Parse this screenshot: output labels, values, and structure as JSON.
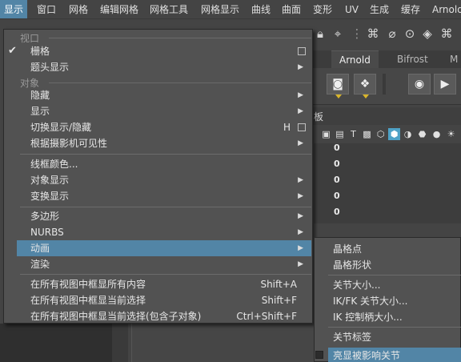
{
  "menubar": {
    "items": [
      "显示",
      "窗口",
      "网格",
      "编辑网格",
      "网格工具",
      "网格显示",
      "曲线",
      "曲面",
      "变形",
      "UV",
      "生成",
      "缓存",
      "Arnold"
    ],
    "active_index": 0
  },
  "toolbar": {
    "icons": [
      "lock-icon",
      "magnet-cursor-icon",
      "snap-grid-icon",
      "snap-curve-icon",
      "snap-point-icon",
      "snap-view-icon",
      "snap-surface-icon",
      "snap-live-icon"
    ]
  },
  "shelf_tabs": {
    "items": [
      "Arnold",
      "Bifrost"
    ],
    "selected": "Arnold"
  },
  "channel_panel": {
    "title": "板",
    "values": [
      "0",
      "0",
      "0",
      "0",
      "0"
    ]
  },
  "display_menu": {
    "sections": {
      "viewport": "视口",
      "object": "对象"
    },
    "items": {
      "grid": "栅格",
      "hud": "题头显示",
      "hide": "隐藏",
      "show": "显示",
      "toggle_show_hide": "切换显示/隐藏",
      "toggle_shortcut": "H",
      "camera_visibility": "根据摄影机可见性",
      "wireframe_color": "线框颜色...",
      "object_display": "对象显示",
      "transform_display": "变换显示",
      "polygons": "多边形",
      "nurbs": "NURBS",
      "animation": "动画",
      "rendering": "渲染",
      "frame_all": "在所有视图中框显所有内容",
      "frame_all_shortcut": "Shift+A",
      "frame_selection": "在所有视图中框显当前选择",
      "frame_selection_shortcut": "Shift+F",
      "frame_selection_children": "在所有视图中框显当前选择(包含子对象)",
      "frame_selection_children_shortcut": "Ctrl+Shift+F"
    },
    "highlighted": "动画"
  },
  "animation_submenu": {
    "items": [
      "晶格点",
      "晶格形状",
      "关节大小...",
      "IK/FK 关节大小...",
      "IK 控制柄大小...",
      "关节标签",
      "亮显被影响关节"
    ],
    "highlighted": "亮显被影响关节"
  },
  "colors": {
    "accent": "#5285a6",
    "menu_bg": "#525252",
    "app_bg": "#444444"
  }
}
